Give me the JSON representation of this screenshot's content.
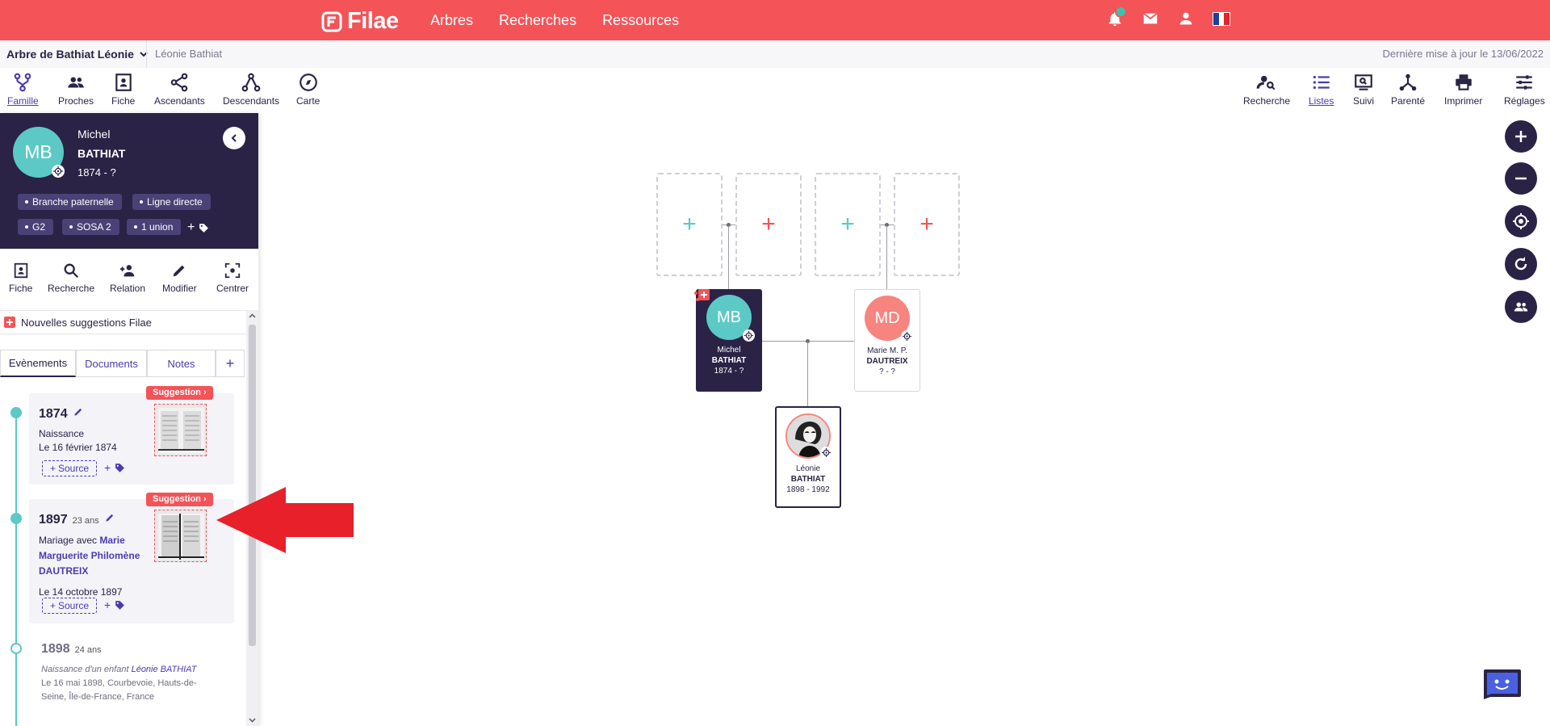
{
  "topnav": {
    "logo": "Filae",
    "links": [
      "Arbres",
      "Recherches",
      "Ressources"
    ],
    "colors": {
      "brand": "#f45358",
      "notification": "#3fc0ae"
    }
  },
  "crumbs": {
    "tree_title": "Arbre de Bathiat Léonie",
    "person": "Léonie Bathiat",
    "last_update": "Dernière mise à jour le 13/06/2022"
  },
  "toolbar": {
    "left": [
      "Famille",
      "Proches",
      "Fiche",
      "Ascendants",
      "Descendants",
      "Carte"
    ],
    "right": [
      "Recherche",
      "Listes",
      "Suivi",
      "Parenté",
      "Imprimer",
      "Réglages"
    ]
  },
  "person": {
    "initials": "MB",
    "first_name": "Michel",
    "last_name": "BATHIAT",
    "dates": "1874 - ?",
    "tags": [
      "Branche paternelle",
      "Ligne directe",
      "G2",
      "SOSA 2",
      "1 union"
    ]
  },
  "actions": [
    "Fiche",
    "Recherche",
    "Relation",
    "Modifier",
    "Centrer"
  ],
  "suggestions_label": "Nouvelles suggestions Filae",
  "tabs": [
    "Evènements",
    "Documents",
    "Notes",
    "+"
  ],
  "events": [
    {
      "year": "1874",
      "type": "Naissance",
      "date": "Le 16 février 1874",
      "source_label": "Source",
      "badge": "Suggestion"
    },
    {
      "year": "1897",
      "age": "23 ans",
      "type_prefix": "Mariage avec",
      "spouse_line1": "Marie",
      "spouse_line2": "Marguerite Philomène",
      "spouse_line3": "DAUTREIX",
      "date": "Le 14 octobre 1897",
      "source_label": "Source",
      "badge": "Suggestion"
    },
    {
      "year": "1898",
      "age": "24 ans",
      "type_prefix": "Naissance d'un enfant",
      "child": "Léonie BATHIAT",
      "place_line1": "Le 16 mai 1898, Courbevoie, Hauts-de-",
      "place_line2": "Seine, Île-de-France, France"
    }
  ],
  "tree": {
    "empty_plus": "+",
    "father": {
      "initials": "MB",
      "first": "Michel",
      "last": "BATHIAT",
      "dates": "1874 - ?"
    },
    "mother": {
      "initials": "MD",
      "first": "Marie M. P.",
      "last": "DAUTREIX",
      "dates": "? - ?"
    },
    "child": {
      "first": "Léonie",
      "last": "BATHIAT",
      "dates": "1898 - 1992"
    }
  }
}
